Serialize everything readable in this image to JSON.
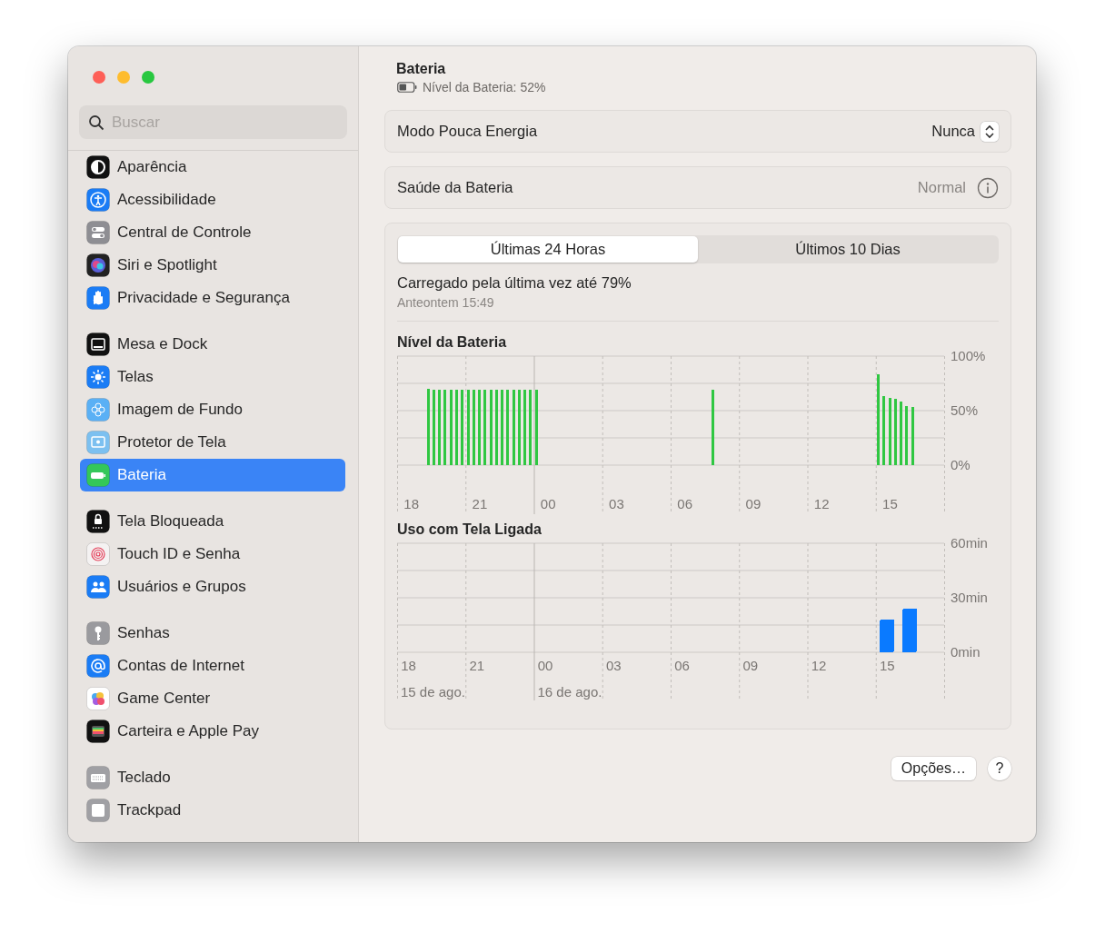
{
  "sidebar": {
    "search": {
      "placeholder": "Buscar"
    },
    "groups": [
      {
        "items": [
          {
            "label": "Aparência",
            "selected": false
          },
          {
            "label": "Acessibilidade",
            "selected": false
          },
          {
            "label": "Central de Controle",
            "selected": false
          },
          {
            "label": "Siri e Spotlight",
            "selected": false
          },
          {
            "label": "Privacidade e Segurança",
            "selected": false
          }
        ]
      },
      {
        "items": [
          {
            "label": "Mesa e Dock",
            "selected": false
          },
          {
            "label": "Telas",
            "selected": false
          },
          {
            "label": "Imagem de Fundo",
            "selected": false
          },
          {
            "label": "Protetor de Tela",
            "selected": false
          },
          {
            "label": "Bateria",
            "selected": true
          }
        ]
      },
      {
        "items": [
          {
            "label": "Tela Bloqueada",
            "selected": false
          },
          {
            "label": "Touch ID e Senha",
            "selected": false
          },
          {
            "label": "Usuários e Grupos",
            "selected": false
          }
        ]
      },
      {
        "items": [
          {
            "label": "Senhas",
            "selected": false
          },
          {
            "label": "Contas de Internet",
            "selected": false
          },
          {
            "label": "Game Center",
            "selected": false
          },
          {
            "label": "Carteira e Apple Pay",
            "selected": false
          }
        ]
      },
      {
        "items": [
          {
            "label": "Teclado",
            "selected": false
          },
          {
            "label": "Trackpad",
            "selected": false
          }
        ]
      }
    ]
  },
  "header": {
    "title": "Bateria",
    "subtitle": "Nível da Bateria: 52%"
  },
  "settings": [
    {
      "label": "Modo Pouca Energia",
      "kind": "popup",
      "value": "Nunca"
    },
    {
      "label": "Saúde da Bateria",
      "kind": "info",
      "value": "Normal"
    }
  ],
  "history": {
    "tabs": [
      {
        "label": "Últimas 24 Horas",
        "selected": true
      },
      {
        "label": "Últimos 10 Dias",
        "selected": false
      }
    ],
    "last_charge": {
      "text": "Carregado pela última vez até 79%",
      "time": "Anteontem 15:49"
    },
    "charts": [
      {
        "chart_data": {
          "type": "bar",
          "title": "Nível da Bateria",
          "color": "#30c742",
          "categories": [
            null,
            null,
            "18",
            null,
            null,
            null,
            null,
            null,
            null,
            null,
            null,
            null,
            null,
            null,
            "21",
            null,
            null,
            null,
            null,
            null,
            null,
            null,
            null,
            null,
            null,
            null,
            "00",
            null,
            null,
            null,
            null,
            null,
            null,
            null,
            null,
            null,
            null,
            null,
            "03",
            null,
            null,
            null,
            null,
            null,
            null,
            null,
            null,
            null,
            null,
            null,
            "06",
            null,
            null,
            null,
            null,
            null,
            null,
            null,
            null,
            null,
            null,
            null,
            "09",
            null,
            null,
            null,
            null,
            null,
            null,
            null,
            null,
            null,
            null,
            null,
            "12",
            null,
            null,
            null,
            null,
            null,
            null,
            null,
            null,
            null,
            null,
            null,
            "15",
            null,
            null,
            null,
            null,
            null,
            null,
            null,
            null,
            null
          ],
          "values": [
            null,
            null,
            null,
            null,
            null,
            70,
            69,
            69,
            69,
            69,
            69,
            69,
            69,
            69,
            69,
            69,
            69,
            69,
            69,
            69,
            69,
            69,
            69,
            69,
            69,
            null,
            null,
            null,
            null,
            null,
            null,
            null,
            null,
            null,
            null,
            null,
            null,
            null,
            null,
            null,
            null,
            null,
            null,
            null,
            null,
            null,
            null,
            null,
            null,
            null,
            null,
            null,
            null,
            null,
            null,
            69,
            null,
            null,
            null,
            null,
            null,
            null,
            null,
            null,
            null,
            null,
            null,
            null,
            null,
            null,
            null,
            null,
            null,
            null,
            null,
            null,
            null,
            null,
            null,
            null,
            null,
            null,
            null,
            null,
            83,
            63,
            62,
            61,
            58,
            54,
            53,
            null,
            null,
            null,
            null,
            null
          ],
          "ylim": [
            0,
            100
          ],
          "yticks": [
            {
              "value": 0,
              "label": "0%"
            },
            {
              "value": 50,
              "label": "50%"
            },
            {
              "value": 100,
              "label": "100%"
            }
          ]
        }
      },
      {
        "chart_data": {
          "type": "bar",
          "title": "Uso com Tela Ligada",
          "color": "#0a7aff",
          "categories": [
            "18",
            null,
            null,
            "21",
            null,
            null,
            "00",
            null,
            null,
            "03",
            null,
            null,
            "06",
            null,
            null,
            "09",
            null,
            null,
            "12",
            null,
            null,
            "15",
            null,
            null
          ],
          "values": [
            null,
            null,
            null,
            null,
            null,
            null,
            null,
            null,
            null,
            null,
            null,
            null,
            null,
            null,
            null,
            null,
            null,
            null,
            null,
            null,
            null,
            18,
            24,
            null
          ],
          "ylim": [
            0,
            60
          ],
          "yticks": [
            {
              "value": 0,
              "label": "0min"
            },
            {
              "value": 30,
              "label": "30min"
            },
            {
              "value": 60,
              "label": "60min"
            }
          ],
          "annotations": [
            "15 de ago.",
            "16 de ago."
          ]
        }
      }
    ]
  },
  "buttons": [
    {
      "label": "Opções…",
      "kind": "text"
    },
    {
      "label": "?",
      "kind": "help"
    }
  ]
}
